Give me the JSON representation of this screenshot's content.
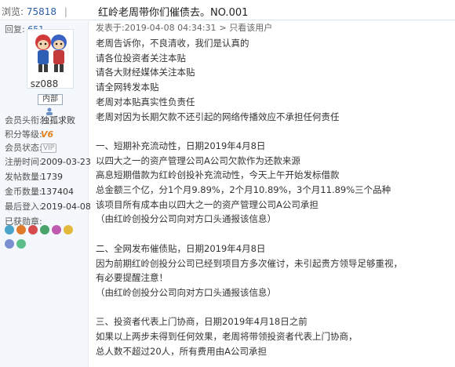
{
  "topbar": {
    "views_label": "浏览:",
    "views_count": "75818",
    "separator": "|",
    "thread_title": "红岭老周带你们催债去。NO.001"
  },
  "sidebar": {
    "replies_label": "回复:",
    "replies_count": "651",
    "username": "sz088",
    "rank": "内部",
    "info": [
      {
        "label": "会员头衔:",
        "value": "独孤求败"
      },
      {
        "label": "积分等级:",
        "value": "V6"
      },
      {
        "label": "会员状态:",
        "value": "VIP"
      },
      {
        "label": "注册时间:",
        "value": "2009-03-23"
      },
      {
        "label": "发帖数量:",
        "value": "1739"
      },
      {
        "label": "金币数量:",
        "value": "137404"
      },
      {
        "label": "最后登入:",
        "value": "2019-04-08"
      }
    ],
    "medals_label": "已获勋章:",
    "medal_colors": [
      "#4aa3c8",
      "#e07b2a",
      "#d64c4c",
      "#4aa36a",
      "#c05ab0",
      "#e2b93b",
      "#7a8fd0",
      "#5cbf8a"
    ]
  },
  "post": {
    "posted_label": "发表于:",
    "posted_time": "2019-04-08 04:34:31",
    "only_author": "> 只看该用户",
    "lines": [
      "老周告诉你，不良清收，我们是认真的",
      "请各位投资者关注本贴",
      "请各大财经媒体关注本贴",
      "请全网转发本贴",
      "老周对本贴真实性负责任",
      "老周对因为长期欠款不还引起的网络传播效应不承担任何责任",
      "",
      "一、短期补充流动性，日期2019年4月8日",
      "以四大之一的资产管理公司A公司欠款作为还款来源",
      "高息短期借款为红岭创投补充流动性，今天上午开始发标借款",
      "总金额三个亿，分1个月9.89%，2个月10.89%，3个月11.89%三个品种",
      "该项目所有成本由以四大之一的资产管理公司A公司承担",
      "（由红岭创投分公司向对方口头通报该信息）",
      "",
      "二、全网发布催债贴，日期2019年4月8日",
      "因为前期红岭创投分公司已经到项目方多次催讨，未引起贵方领导足够重视，",
      "有必要提醒注意！",
      "（由红岭创投分公司向对方口头通报该信息）",
      "",
      "三、投资者代表上门协商，日期2019年4月18日之前",
      "如果以上两步未得到任何效果，老周将带领投资者代表上门协商，",
      "总人数不超过20人，所有费用由A公司承担"
    ]
  }
}
